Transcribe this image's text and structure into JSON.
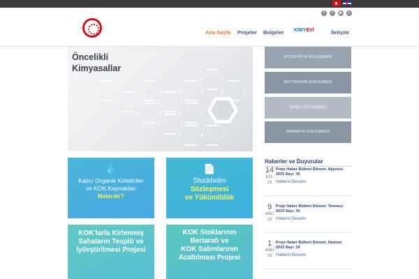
{
  "nav": {
    "home": "Ana Sayfa",
    "projects": "Projeler",
    "docs": "Belgeler",
    "kimyevi_a": "KİMY",
    "kimyevi_b": "EVİ",
    "contact": "İletişim"
  },
  "hero": {
    "line1": "Öncelikli",
    "line2": "Kimyasallar"
  },
  "conventions": [
    "STOCKHOLM SÖZLEŞMESİ",
    "ROTTERDAM SÖZLEŞMESİ",
    "BASEL SÖZLEŞMESİ",
    "MİNAMATA SÖZLEŞMESİ"
  ],
  "tiles": {
    "t1": {
      "l1": "Kalıcı Organik Kirleticiler",
      "l2": "ve KOK Kaynakları",
      "l3": "Nelerdir?"
    },
    "t2": {
      "l1": "Stockholm",
      "l2": "Sözleşmesi",
      "l3": "ve Yükümlülük"
    },
    "t3": {
      "l1": "KOK'larla Kirlenmiş",
      "l2": "Sahaların Tespiti ve",
      "l3": "İyileştirilmesi Projesi"
    },
    "t4": {
      "l1": "KOK Stoklarının",
      "l2": "Bertarafı ve",
      "l3": "KOK Salımlarının",
      "l4": "Azaltılması Projesi"
    }
  },
  "news": {
    "title": "Haberler ve Duyurular",
    "items": [
      {
        "day": "14",
        "month": "EYL",
        "year": "23",
        "headline": "Proje Haber Bülteni Dönem: Ağustos 2023 Sayı: 36",
        "more": "Haberin Devamı"
      },
      {
        "day": "9",
        "month": "AĞU",
        "year": "23",
        "headline": "Proje Haber Bülteni Dönem: Temmuz 2023 Sayı: 35",
        "more": "Haberin Devamı"
      },
      {
        "day": "1",
        "month": "AĞU",
        "year": "23",
        "headline": "Proje Haber Bülteni Dönem: Haziran 2023 Sayı: 34",
        "more": "Haberin Devamı"
      }
    ]
  },
  "colors": {
    "accent": "#e8792a",
    "navy": "#3b5a86",
    "tile_blue": "#47a9e0",
    "tile_teal": "#5dc7c0"
  },
  "icons": [
    "turkish-flag-icon",
    "english-flag-icon",
    "facebook-icon",
    "twitter-icon",
    "youtube-icon",
    "vimeo-icon",
    "droplet-icon",
    "document-icon"
  ]
}
